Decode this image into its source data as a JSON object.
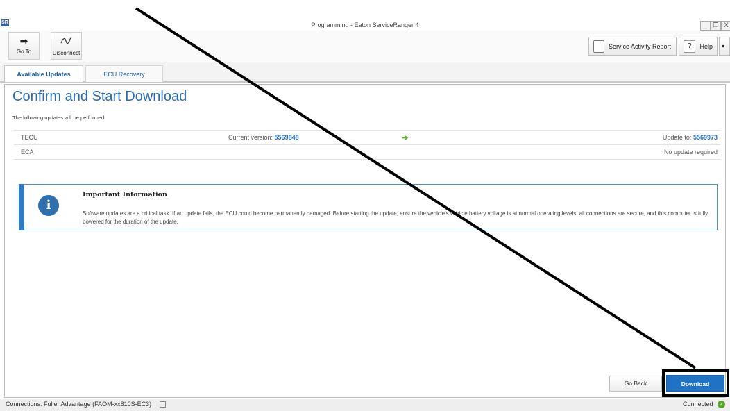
{
  "window": {
    "app_icon": "SR",
    "title": "Programming - Eaton ServiceRanger 4",
    "minimize": "_",
    "restore": "❐",
    "close": "X"
  },
  "toolbar": {
    "goto_label": "Go To",
    "goto_icon": "arrow-right-icon",
    "disconnect_label": "Disconnect",
    "disconnect_icon": "cable-icon",
    "service_report_label": "Service Activity Report",
    "help_label": "Help",
    "help_icon_text": "?",
    "dropdown": "▾"
  },
  "tabs": [
    {
      "label": "Available Updates",
      "active": true
    },
    {
      "label": "ECU Recovery",
      "active": false
    }
  ],
  "main": {
    "title": "Confirm and Start Download",
    "description": "The following updates will be performed:",
    "updates": [
      {
        "ecu": "TECU",
        "current_label": "Current version:",
        "current_value": "5569848",
        "update_label": "Update to:",
        "update_value": "5569973"
      },
      {
        "ecu": "ECA",
        "status": "No update required"
      }
    ],
    "arrow": "➔"
  },
  "info": {
    "icon_text": "i",
    "title": "Important Information",
    "text": "Software updates are a critical task.  If an update fails, the ECU could become permanently damaged.  Before starting the update, ensure the vehicle's vehicle battery voltage is at normal operating levels, all connections are secure, and this computer is fully powered for the duration of the update."
  },
  "buttons": {
    "back": "Go Back",
    "download": "Download"
  },
  "status": {
    "connections": "Connections: Fuller Advantage (FAOM-xx810S-EC3)",
    "connected": "Connected",
    "ok_icon": "✓"
  },
  "colors": {
    "accent": "#1f72c6",
    "title_blue": "#2a6cb3",
    "ok_green": "#5aaa2a",
    "arrow_green": "#5fae2e"
  }
}
